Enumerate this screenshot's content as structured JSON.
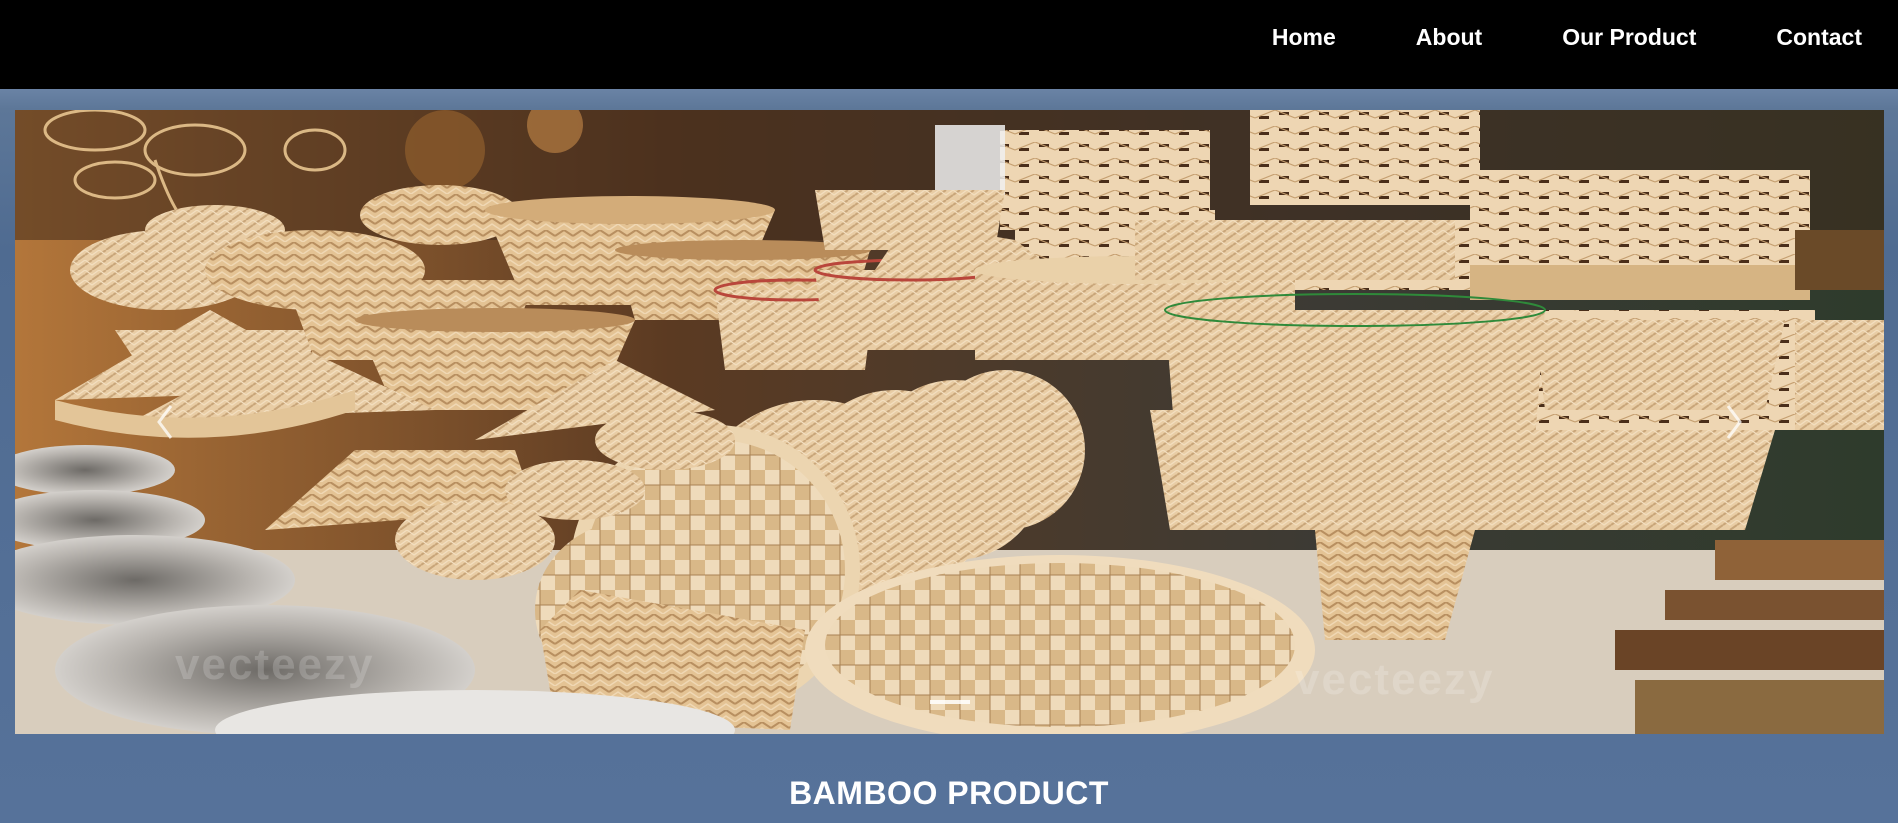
{
  "nav": {
    "items": [
      {
        "label": "Home"
      },
      {
        "label": "About"
      },
      {
        "label": "Our Product"
      },
      {
        "label": "Contact"
      }
    ]
  },
  "carousel": {
    "image_subject": "bamboo baskets market stall",
    "prev_icon": "chevron-left-icon",
    "next_icon": "chevron-right-icon",
    "slide_count": 1,
    "active_slide": 1,
    "watermark": "vecteezy"
  },
  "section": {
    "title": "BAMBOO PRODUCT"
  },
  "colors": {
    "navbar_bg": "#000000",
    "band_bg": "#4f6b91",
    "text": "#ffffff",
    "bamboo": "#e7c79c"
  }
}
